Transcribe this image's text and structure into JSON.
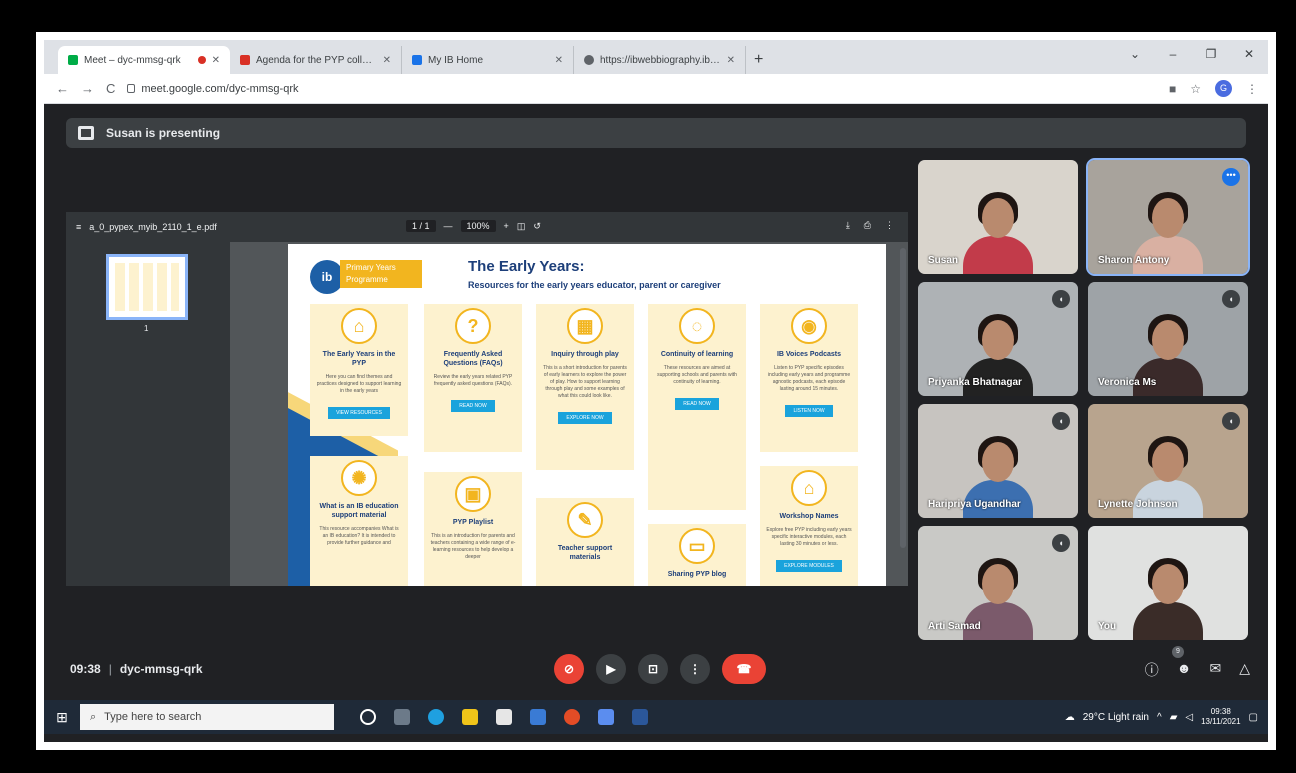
{
  "browser": {
    "tabs": [
      {
        "title": "Meet – dyc-mmsg-qrk",
        "color": "#00ac47",
        "close": "✕",
        "active": true
      },
      {
        "title": "Agenda for the PYP collaboration",
        "color": "#d93025",
        "close": "✕",
        "active": false
      },
      {
        "title": "My IB Home",
        "color": "#1a73e8",
        "close": "✕",
        "active": false
      },
      {
        "title": "https://ibwebbiography.ibo.org",
        "color": "#5f6368",
        "close": "✕",
        "active": false
      }
    ],
    "new_tab": "+",
    "url": "meet.google.com/dyc-mmsg-qrk",
    "profile_initial": "G"
  },
  "presenting": {
    "text": "Susan is presenting"
  },
  "pdf": {
    "filename": "a_0_pypex_myib_2110_1_e.pdf",
    "page_indicator": "1 / 1",
    "zoom": "100%",
    "thumb_page": "1",
    "page": {
      "logo_text": "ib",
      "programme_tag": "Primary Years Programme",
      "title": "The Early Years:",
      "subtitle": "Resources for the early years educator, parent or caregiver",
      "cards": [
        {
          "icon": "⌂",
          "title": "The Early Years in the PYP",
          "desc": "Here you can find themes and practices designed to support learning in the early years",
          "btn": "VIEW RESOURCES"
        },
        {
          "icon": "?",
          "title": "Frequently Asked Questions (FAQs)",
          "desc": "Review the early years related PYP frequently asked questions (FAQs).",
          "btn": "READ NOW"
        },
        {
          "icon": "▦",
          "title": "Inquiry through play",
          "desc": "This is a short introduction for parents of early learners to explore the power of play. How to support learning through play and some examples of what this could look like.",
          "btn": "EXPLORE NOW"
        },
        {
          "icon": "◌",
          "title": "Continuity of learning",
          "desc": "These resources are aimed at supporting schools and parents with continuity of learning.",
          "btn": "READ NOW"
        },
        {
          "icon": "◉",
          "title": "IB Voices Podcasts",
          "desc": "Listen to PYP specific episodes including early years and programme agnostic podcasts, each episode lasting around 15 minutes.",
          "btn": "LISTEN NOW"
        },
        {
          "icon": "✺",
          "title": "What is an IB education support material",
          "desc": "This resource accompanies What is an IB education? It is intended to provide further guidance and",
          "btn": ""
        },
        {
          "icon": "▣",
          "title": "PYP Playlist",
          "desc": "This is an introduction for parents and teachers containing a wide range of e-learning resources to help develop a deeper",
          "btn": ""
        },
        {
          "icon": "✎",
          "title": "Teacher support materials",
          "desc": "",
          "btn": ""
        },
        {
          "icon": "▭",
          "title": "Sharing PYP blog",
          "desc": "",
          "btn": ""
        },
        {
          "icon": "⌂",
          "title": "Workshop Names",
          "desc": "Explore free PYP including early years specific interactive modules, each lasting 30 minutes or less.",
          "btn": "EXPLORE MODULES"
        }
      ]
    }
  },
  "participants": [
    {
      "name": "Susan",
      "muted": false,
      "more": false,
      "bg": "#d9d4cc",
      "shirt": "#c23b4a"
    },
    {
      "name": "Sharon Antony",
      "muted": false,
      "more": true,
      "bg": "#a8a39c",
      "shirt": "#d9b0a2"
    },
    {
      "name": "Priyanka Bhatnagar",
      "muted": true,
      "more": false,
      "bg": "#aeb2b5",
      "shirt": "#222"
    },
    {
      "name": "Veronica Ms",
      "muted": true,
      "more": false,
      "bg": "#9ea3a7",
      "shirt": "#3a2a2a"
    },
    {
      "name": "Haripriya Ugandhar",
      "muted": true,
      "more": false,
      "bg": "#c7c4c0",
      "shirt": "#3c6fb0"
    },
    {
      "name": "Lynette Johnson",
      "muted": true,
      "more": false,
      "bg": "#b8a48e",
      "shirt": "#c9d4de"
    },
    {
      "name": "Arti Samad",
      "muted": true,
      "more": false,
      "bg": "#c9c9c6",
      "shirt": "#7b5a6b"
    },
    {
      "name": "You",
      "muted": false,
      "more": false,
      "bg": "#e0e1e0",
      "shirt": "#3a2c28"
    }
  ],
  "meeting": {
    "time": "09:38",
    "code": "dyc-mmsg-qrk",
    "people_count": "9"
  },
  "taskbar": {
    "search_placeholder": "Type here to search",
    "weather": "29°C  Light rain",
    "time": "09:38",
    "date": "13/11/2021"
  }
}
